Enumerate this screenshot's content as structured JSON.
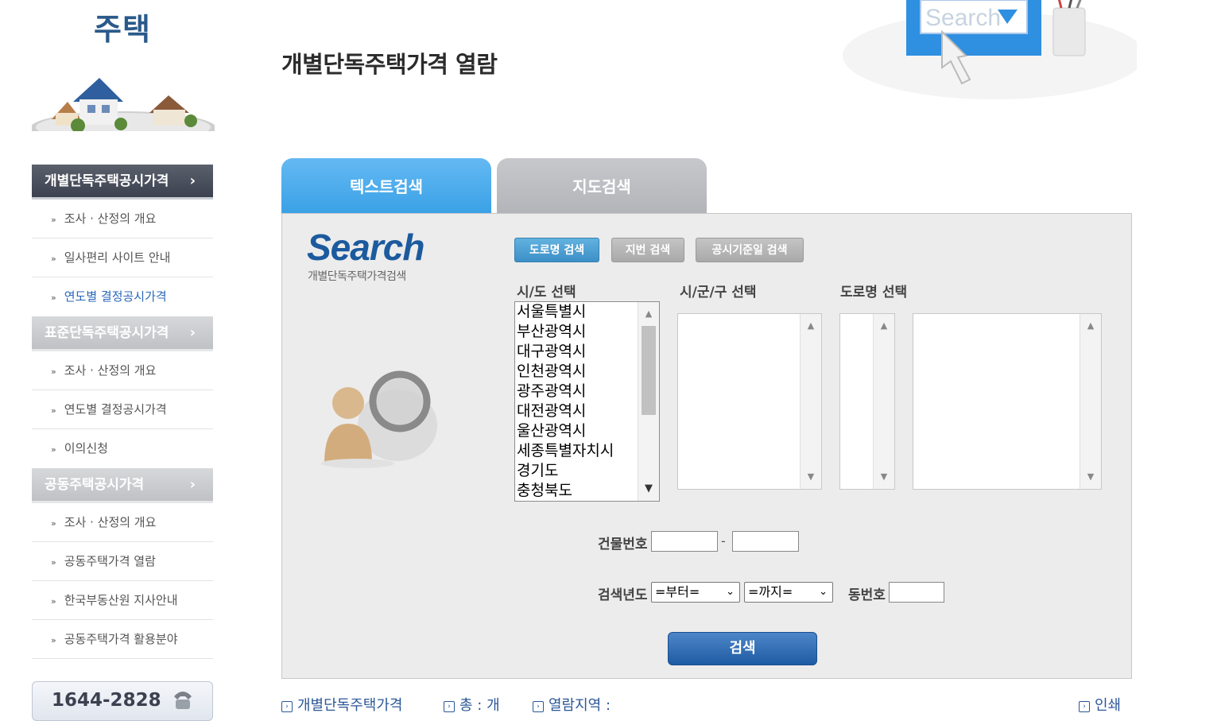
{
  "sidebar": {
    "title": "주택",
    "sections": [
      {
        "heading": "개별단독주택공시가격",
        "items": [
          "조사 · 산정의 개요",
          "일사편리 사이트 안내",
          "연도별 결정공시가격"
        ]
      },
      {
        "heading": "표준단독주택공시가격",
        "items": [
          "조사 · 산정의 개요",
          "연도별 결정공시가격",
          "이의신청"
        ]
      },
      {
        "heading": "공동주택공시가격",
        "items": [
          "조사 · 산정의 개요",
          "공동주택가격 열람",
          "한국부동산원 지사안내",
          "공동주택가격 활용분야"
        ]
      }
    ],
    "active_item": "연도별 결정공시가격",
    "phone": "1644-2828"
  },
  "header": {
    "page_title": "개별단독주택가격 열람",
    "illustration_text": "Search"
  },
  "tabs": [
    "텍스트검색",
    "지도검색"
  ],
  "search": {
    "logo": "Search",
    "logo_sub": "개별단독주택가격검색",
    "modes": [
      "도로명 검색",
      "지번 검색",
      "공시기준일 검색"
    ],
    "labels": {
      "sido": "시/도 선택",
      "sigungu": "시/군/구 선택",
      "road": "도로명 선택",
      "building_no": "건물번호",
      "year": "검색년도",
      "dong_no": "동번호"
    },
    "sido_options": [
      "서울특별시",
      "부산광역시",
      "대구광역시",
      "인천광역시",
      "광주광역시",
      "대전광역시",
      "울산광역시",
      "세종특별자치시",
      "경기도",
      "충청북도"
    ],
    "dash": "-",
    "year_from": "=부터=",
    "year_to": "=까지=",
    "submit": "검색"
  },
  "info_bar": {
    "category": "개별단독주택가격",
    "total": "총 : 개",
    "region": "열람지역 :",
    "print": "인쇄"
  },
  "colors": {
    "active_tab": "#3aa1e6",
    "nav_active": "#3c4150",
    "accent_blue": "#2867b8",
    "search_button": "#1f5ba4"
  }
}
